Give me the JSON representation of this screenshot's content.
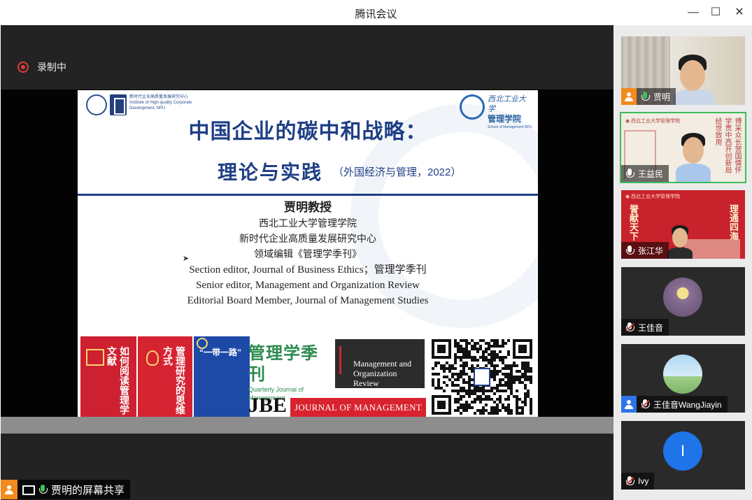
{
  "window": {
    "title": "腾讯会议",
    "minimize_glyph": "—",
    "maximize_glyph": "☐",
    "close_glyph": "✕"
  },
  "recording": {
    "label": "录制中",
    "color": "#e23b3b"
  },
  "slide": {
    "logo_left_text": "新时代企业高质量发展研究中心 Institute of High-quality Corporate Development, NPU",
    "logo_right_cn": "西北工业大学",
    "logo_right_dept": "管理学院",
    "logo_right_en": "School of Management NPU",
    "title": "中国企业的碳中和战略：",
    "subtitle": "理论与实践",
    "subtitle_note": "（外国经济与管理，2022）",
    "professor": "贾明教授",
    "affiliations": [
      "西北工业大学管理学院",
      "新时代企业高质量发展研究中心",
      "领域编辑《管理学季刊》"
    ],
    "roles_en": [
      "Section editor, Journal of Business Ethics；管理学季刊",
      "Senior editor, Management and Organization Review",
      "Editorial Board Member, Journal of Management Studies"
    ],
    "books": [
      {
        "title": "如何阅读管理学文献"
      },
      {
        "title": "管理研究的思维方式"
      },
      {
        "title": "“一带一路”"
      }
    ],
    "qjm_title": "管理学季刊",
    "qjm_en": "Quarterly Journal of Management",
    "mor_title": "Management and Organization Review",
    "jbe": "JBE",
    "jms": "JOURNAL OF MANAGEMENT STUDIES"
  },
  "participants": [
    {
      "name": "贾明",
      "host": true,
      "host_color": "#f28a1e",
      "mic": "on"
    },
    {
      "name": "王益民",
      "host": false,
      "mic": "idle",
      "active_speaker": true
    },
    {
      "name": "张江华",
      "host": false,
      "mic": "idle"
    },
    {
      "name": "王佳音",
      "host": false,
      "mic": "muted"
    },
    {
      "name": "王佳音WangJiayin",
      "host": true,
      "host_color": "#2d74e8",
      "mic": "muted"
    },
    {
      "name": "Ivy",
      "host": false,
      "mic": "muted",
      "avatar_letter": "I"
    }
  ],
  "share": {
    "label": "贾明的屏幕共享"
  },
  "colors": {
    "accent_green": "#3dbb5a",
    "host_orange": "#f28a1e",
    "slide_blue": "#1f3f86"
  }
}
